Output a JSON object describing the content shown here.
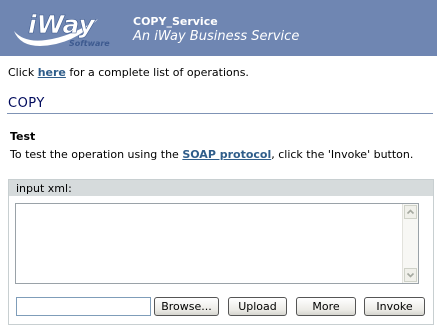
{
  "header": {
    "logo_text": "iWay",
    "logo_subtext": "Software",
    "service_name": "COPY_Service",
    "service_subtitle": "An iWay Business Service",
    "bg_color": "#6f86b2"
  },
  "operations_line": {
    "prefix": "Click ",
    "link": "here",
    "suffix": " for a complete list of operations."
  },
  "operation": {
    "title": "COPY"
  },
  "test": {
    "heading": "Test",
    "desc_prefix": "To test the operation using the ",
    "desc_link": "SOAP protocol",
    "desc_suffix": ", click the 'Invoke' button."
  },
  "form": {
    "panel_label": "input xml:",
    "xml_value": "",
    "file_value": "",
    "browse_label": "Browse...",
    "upload_label": "Upload",
    "more_label": "More",
    "invoke_label": "Invoke"
  },
  "colors": {
    "link": "#2f5d8a",
    "title": "#000a5c",
    "panel_header": "#d6dbdc"
  }
}
